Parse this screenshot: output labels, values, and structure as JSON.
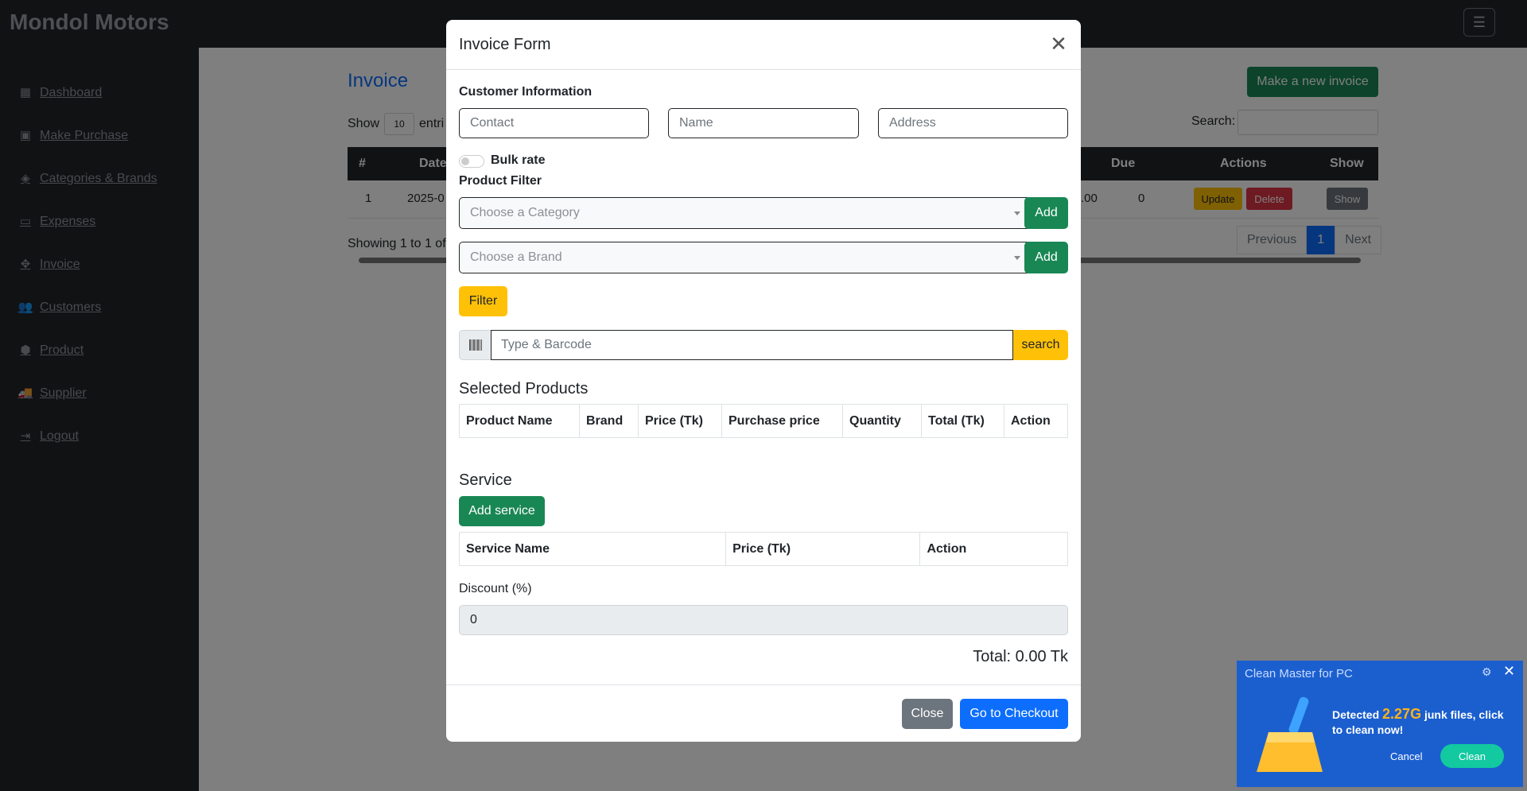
{
  "app": {
    "brand": "Mondol Motors",
    "menu_icon": "hamburger-icon"
  },
  "sidebar": {
    "items": [
      {
        "label": "Dashboard",
        "icon": "dashboard-icon"
      },
      {
        "label": "Make Purchase",
        "icon": "money-icon"
      },
      {
        "label": "Categories & Brands",
        "icon": "tags-icon"
      },
      {
        "label": "Expenses",
        "icon": "money-bill-icon"
      },
      {
        "label": "Invoice",
        "icon": "arrows-icon"
      },
      {
        "label": "Customers",
        "icon": "users-icon"
      },
      {
        "label": "Product",
        "icon": "box-icon"
      },
      {
        "label": "Supplier",
        "icon": "truck-icon"
      },
      {
        "label": "Logout",
        "icon": "logout-icon"
      }
    ]
  },
  "background": {
    "title": "Invoice",
    "new_invoice": "Make a new invoice",
    "show_label": "Show",
    "entries_value": "10",
    "entries_label": "entri",
    "search_label": "Search:",
    "headers": {
      "num": "#",
      "date": "Date",
      "due": "Due",
      "actions": "Actions",
      "show": "Show"
    },
    "row": {
      "num": "1",
      "date": "2025-0",
      "amount": ".00",
      "due": "0",
      "update": "Update",
      "delete": "Delete",
      "show": "Show"
    },
    "showing": "Showing 1 to 1 of",
    "pager": {
      "prev": "Previous",
      "page": "1",
      "next": "Next"
    }
  },
  "modal": {
    "title": "Invoice Form",
    "customer_info": "Customer Information",
    "contact_placeholder": "Contact",
    "name_placeholder": "Name",
    "address_placeholder": "Address",
    "bulk_rate": "Bulk rate",
    "product_filter": "Product Filter",
    "category_placeholder": "Choose a Category",
    "brand_placeholder": "Choose a Brand",
    "add_label": "Add",
    "filter_label": "Filter",
    "barcode_placeholder": "Type & Barcode",
    "search_label": "search",
    "selected_products": "Selected Products",
    "product_columns": [
      "Product Name",
      "Brand",
      "Price (Tk)",
      "Purchase price",
      "Quantity",
      "Total (Tk)",
      "Action"
    ],
    "service_title": "Service",
    "add_service": "Add service",
    "service_columns": [
      "Service Name",
      "Price (Tk)",
      "Action"
    ],
    "discount_label": "Discount (%)",
    "discount_value": "0",
    "total": "Total: 0.00 Tk",
    "close_label": "Close",
    "checkout_label": "Go to Checkout"
  },
  "popup": {
    "title": "Clean Master for PC",
    "msg_pre": "Detected ",
    "size": "2.27G",
    "msg_post": " junk files, click to clean now!",
    "cancel": "Cancel",
    "clean": "Clean"
  }
}
